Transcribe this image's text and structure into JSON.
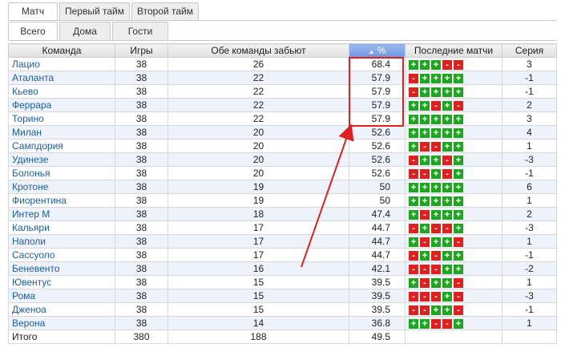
{
  "tabs_period": [
    {
      "label": "Матч",
      "active": true
    },
    {
      "label": "Первый тайм",
      "active": false
    },
    {
      "label": "Второй тайм",
      "active": false
    }
  ],
  "tabs_venue": [
    {
      "label": "Всего",
      "active": true
    },
    {
      "label": "Дома",
      "active": false
    },
    {
      "label": "Гости",
      "active": false
    }
  ],
  "table": {
    "headers": {
      "team": "Команда",
      "games": "Игры",
      "btts": "Обе команды забьют",
      "percent": "%",
      "sort_indicator": "▲",
      "last_matches": "Последние матчи",
      "streak": "Серия"
    },
    "rows": [
      {
        "team": "Лацио",
        "games": "38",
        "btts": "26",
        "pct": "68.4",
        "last": [
          "+",
          "+",
          "+",
          "-",
          "-"
        ],
        "streak": "3"
      },
      {
        "team": "Аталанта",
        "games": "38",
        "btts": "22",
        "pct": "57.9",
        "last": [
          "-",
          "+",
          "+",
          "+",
          "+"
        ],
        "streak": "-1"
      },
      {
        "team": "Кьево",
        "games": "38",
        "btts": "22",
        "pct": "57.9",
        "last": [
          "-",
          "+",
          "+",
          "+",
          "+"
        ],
        "streak": "-1"
      },
      {
        "team": "Феррара",
        "games": "38",
        "btts": "22",
        "pct": "57.9",
        "last": [
          "+",
          "+",
          "-",
          "+",
          "-"
        ],
        "streak": "2"
      },
      {
        "team": "Торино",
        "games": "38",
        "btts": "22",
        "pct": "57.9",
        "last": [
          "+",
          "+",
          "+",
          "+",
          "+"
        ],
        "streak": "3"
      },
      {
        "team": "Милан",
        "games": "38",
        "btts": "20",
        "pct": "52.6",
        "last": [
          "+",
          "+",
          "+",
          "+",
          "+"
        ],
        "streak": "4"
      },
      {
        "team": "Сампдория",
        "games": "38",
        "btts": "20",
        "pct": "52.6",
        "last": [
          "+",
          "-",
          "-",
          "+",
          "+"
        ],
        "streak": "1"
      },
      {
        "team": "Удинезе",
        "games": "38",
        "btts": "20",
        "pct": "52.6",
        "last": [
          "-",
          "+",
          "+",
          "-",
          "+"
        ],
        "streak": "-3"
      },
      {
        "team": "Болонья",
        "games": "38",
        "btts": "20",
        "pct": "52.6",
        "last": [
          "-",
          "-",
          "+",
          "-",
          "+"
        ],
        "streak": "-1"
      },
      {
        "team": "Кротоне",
        "games": "38",
        "btts": "19",
        "pct": "50",
        "last": [
          "+",
          "+",
          "+",
          "+",
          "+"
        ],
        "streak": "6"
      },
      {
        "team": "Фиорентина",
        "games": "38",
        "btts": "19",
        "pct": "50",
        "last": [
          "+",
          "+",
          "+",
          "+",
          "+"
        ],
        "streak": "1"
      },
      {
        "team": "Интер М",
        "games": "38",
        "btts": "18",
        "pct": "47.4",
        "last": [
          "+",
          "-",
          "+",
          "+",
          "+"
        ],
        "streak": "2"
      },
      {
        "team": "Кальяри",
        "games": "38",
        "btts": "17",
        "pct": "44.7",
        "last": [
          "-",
          "+",
          "-",
          "-",
          "+"
        ],
        "streak": "-3"
      },
      {
        "team": "Наполи",
        "games": "38",
        "btts": "17",
        "pct": "44.7",
        "last": [
          "+",
          "-",
          "+",
          "+",
          "-"
        ],
        "streak": "1"
      },
      {
        "team": "Сассуоло",
        "games": "38",
        "btts": "17",
        "pct": "44.7",
        "last": [
          "-",
          "+",
          "-",
          "+",
          "+"
        ],
        "streak": "-1"
      },
      {
        "team": "Беневенто",
        "games": "38",
        "btts": "16",
        "pct": "42.1",
        "last": [
          "-",
          "-",
          "-",
          "+",
          "+"
        ],
        "streak": "-2"
      },
      {
        "team": "Ювентус",
        "games": "38",
        "btts": "15",
        "pct": "39.5",
        "last": [
          "+",
          "-",
          "+",
          "+",
          "-"
        ],
        "streak": "1"
      },
      {
        "team": "Рома",
        "games": "38",
        "btts": "15",
        "pct": "39.5",
        "last": [
          "-",
          "-",
          "-",
          "+",
          "-"
        ],
        "streak": "-3"
      },
      {
        "team": "Дженоа",
        "games": "38",
        "btts": "15",
        "pct": "39.5",
        "last": [
          "-",
          "-",
          "+",
          "+",
          "-"
        ],
        "streak": "-1"
      },
      {
        "team": "Верона",
        "games": "38",
        "btts": "14",
        "pct": "36.8",
        "last": [
          "+",
          "+",
          "-",
          "-",
          "+"
        ],
        "streak": "1"
      }
    ],
    "total": {
      "label": "Итого",
      "games": "380",
      "btts": "188",
      "pct": "49.5"
    }
  },
  "colors": {
    "win": "#1fa51f",
    "loss": "#e0201e",
    "highlight": "#e02020",
    "team_link": "#1b5fa8"
  }
}
